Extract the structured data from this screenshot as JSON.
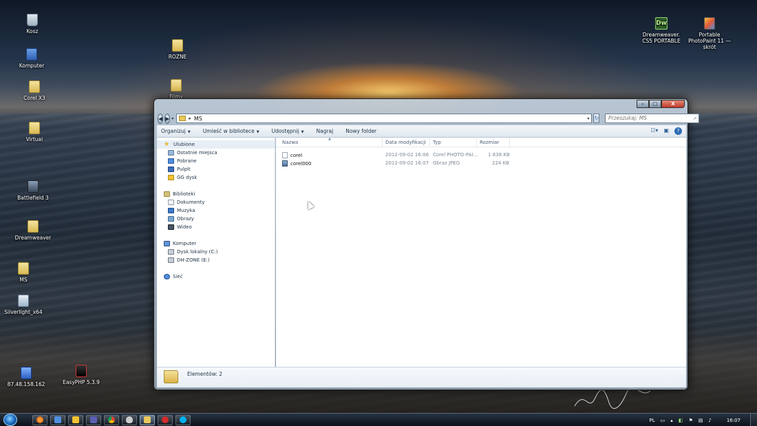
{
  "desktop": {
    "icons": [
      {
        "label": "Kosz",
        "icon": "recycle-bin-icon"
      },
      {
        "label": "Komputer",
        "icon": "computer-icon"
      },
      {
        "label": "Corel X3",
        "icon": "folder-icon"
      },
      {
        "label": "Virtual",
        "icon": "folder-icon"
      },
      {
        "label": "Battlefield 3",
        "icon": "game-icon"
      },
      {
        "label": "Dreamweaver",
        "icon": "folder-icon"
      },
      {
        "label": "MS",
        "icon": "folder-icon"
      },
      {
        "label": "Silverlight_x64",
        "icon": "installer-icon"
      },
      {
        "label": "87.48.158.162",
        "icon": "network-shortcut-icon"
      },
      {
        "label": "EasyPHP 5.3.9",
        "icon": "easyphp-icon"
      },
      {
        "label": "ROZNE",
        "icon": "folder-icon"
      },
      {
        "label": "Filmy",
        "icon": "folder-icon"
      },
      {
        "label": "Dreamweaver. CS5 PORTABLE",
        "icon": "dreamweaver-icon",
        "glyph": "Dw"
      },
      {
        "label": "Portable PhotoPaint 11 — skrót",
        "icon": "photopaint-icon"
      }
    ]
  },
  "explorer": {
    "caption": {
      "min": "–",
      "max": "□",
      "close": "X"
    },
    "nav": {
      "back": "◀",
      "forward": "▶"
    },
    "address": {
      "folder": "MS",
      "separator": "▸"
    },
    "search": {
      "placeholder": "Przeszukaj: MS"
    },
    "toolbar": {
      "items": [
        "Organizuj",
        "Umieść w bibliotece",
        "Udostępnij",
        "Nagraj",
        "Nowy folder"
      ],
      "help": "?"
    },
    "navpane": {
      "favorites": {
        "label": "Ulubione",
        "items": [
          "Ostatnie miejsca",
          "Pobrane",
          "Pulpit",
          "GG dysk"
        ]
      },
      "libraries": {
        "label": "Biblioteki",
        "items": [
          "Dokumenty",
          "Muzyka",
          "Obrazy",
          "Wideo"
        ]
      },
      "computer": {
        "label": "Komputer",
        "items": [
          "Dysk lokalny (C:)",
          "DH-ZONE (E:)"
        ]
      },
      "network": {
        "label": "Sieć"
      }
    },
    "columns": [
      "Nazwa",
      "Data modyfikacji",
      "Typ",
      "Rozmiar"
    ],
    "files": [
      {
        "name": "corel",
        "date": "2012-09-02 16:06",
        "type": "Corel PHOTO-PAI...",
        "size": "1 838 KB",
        "icon": "document-icon"
      },
      {
        "name": "corel000",
        "date": "2012-09-02 16:07",
        "type": "Obraz JPEG",
        "size": "224 KB",
        "icon": "jpeg-image-icon"
      }
    ],
    "status": {
      "count_label": "Elementów: 2"
    }
  },
  "taskbar": {
    "tray": {
      "language": "PL",
      "time": "16:07"
    }
  },
  "colors": {
    "accent": "#2e6db4",
    "window_frame": "#bfcddc"
  }
}
